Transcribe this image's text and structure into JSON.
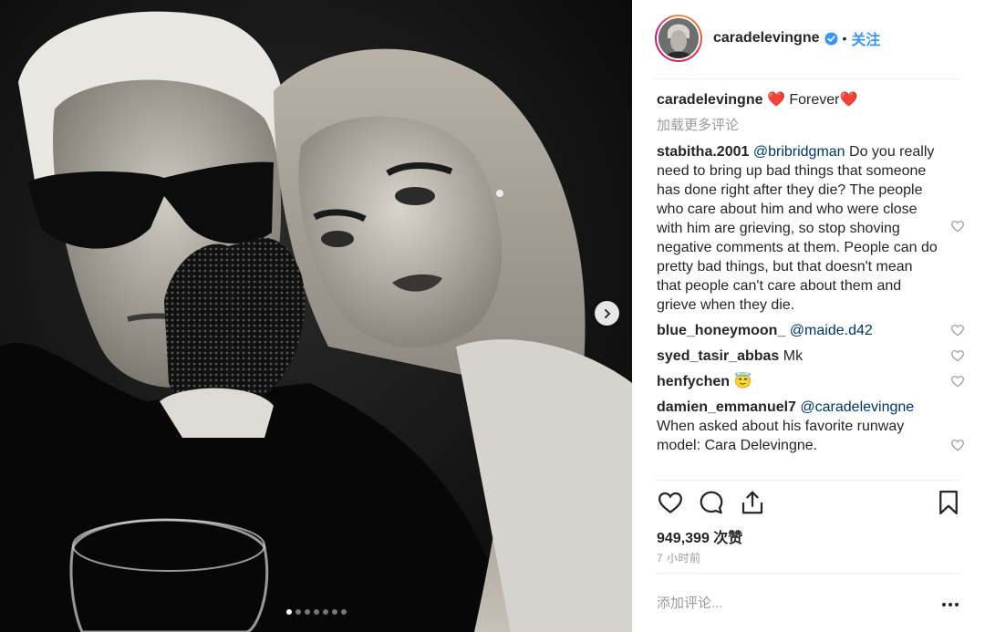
{
  "post": {
    "author": "caradelevingne",
    "follow_label": "关注",
    "bullet": "•",
    "caption": {
      "username": "caradelevingne",
      "text": "Forever",
      "emoji_left": "❤️",
      "emoji_right": "❤️"
    },
    "load_more_label": "加载更多评论",
    "comments": [
      {
        "username": "stabitha.2001",
        "mention": "@bribridgman",
        "text": "Do you really need to bring up bad things that someone has done right after they die? The people who care about him and who were close with him are grieving, so stop shoving negative comments at them. People can do pretty bad things, but that doesn't mean that people can't care about them and grieve when they die."
      },
      {
        "username": "blue_honeymoon_",
        "mention": "@maide.d42",
        "text": ""
      },
      {
        "username": "syed_tasir_abbas",
        "mention": "",
        "text": "Mk"
      },
      {
        "username": "henfychen",
        "mention": "",
        "text": "😇"
      },
      {
        "username": "damien_emmanuel7",
        "mention": "@caradelevingne",
        "text": "When asked about his favorite runway model: Cara Delevingne."
      }
    ],
    "likes_label": "949,399 次赞",
    "time_label": "7 小时前",
    "add_comment_placeholder": "添加评论...",
    "carousel": {
      "slides": 7,
      "active_index": 0
    }
  },
  "colors": {
    "accent": "#3897f0",
    "text": "#262626",
    "muted": "#999999",
    "mention": "#003569",
    "divider": "#efefef"
  },
  "icons": [
    "heart-icon",
    "comment-icon",
    "share-icon",
    "bookmark-icon",
    "verified-icon",
    "chevron-right-icon",
    "more-options-icon"
  ]
}
